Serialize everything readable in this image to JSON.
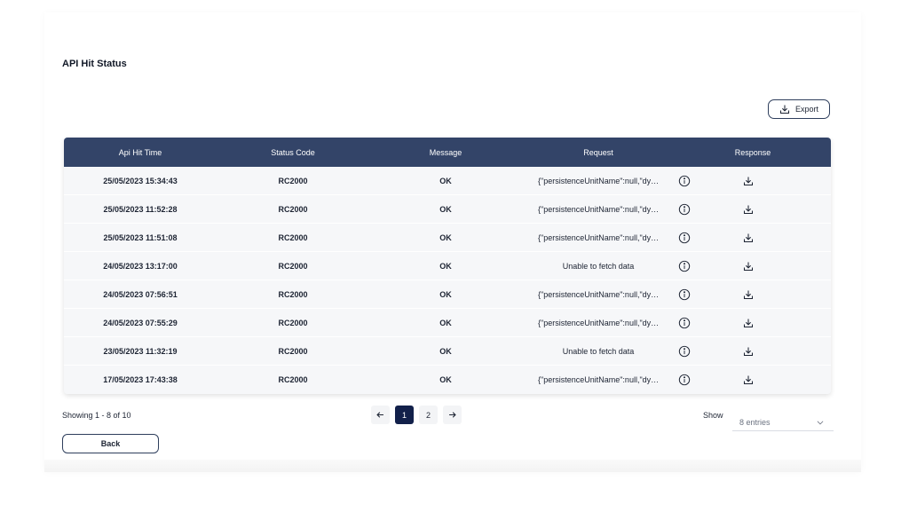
{
  "page": {
    "title": "API Hit Status"
  },
  "toolbar": {
    "export_label": "Export",
    "export_icon": "download-icon"
  },
  "table": {
    "columns": [
      "Api Hit Time",
      "Status Code",
      "Message",
      "Request",
      "Response"
    ],
    "rows": [
      {
        "time": "25/05/2023 15:34:43",
        "status": "RC2000",
        "message": "OK",
        "request": "{\"persistenceUnitName\":null,\"dynami...",
        "request_truncated": true
      },
      {
        "time": "25/05/2023 11:52:28",
        "status": "RC2000",
        "message": "OK",
        "request": "{\"persistenceUnitName\":null,\"dynami...",
        "request_truncated": true
      },
      {
        "time": "25/05/2023 11:51:08",
        "status": "RC2000",
        "message": "OK",
        "request": "{\"persistenceUnitName\":null,\"dynami...",
        "request_truncated": true
      },
      {
        "time": "24/05/2023 13:17:00",
        "status": "RC2000",
        "message": "OK",
        "request": "Unable to fetch data",
        "request_truncated": false
      },
      {
        "time": "24/05/2023 07:56:51",
        "status": "RC2000",
        "message": "OK",
        "request": "{\"persistenceUnitName\":null,\"dynami...",
        "request_truncated": true
      },
      {
        "time": "24/05/2023 07:55:29",
        "status": "RC2000",
        "message": "OK",
        "request": "{\"persistenceUnitName\":null,\"dynami...",
        "request_truncated": true
      },
      {
        "time": "23/05/2023 11:32:19",
        "status": "RC2000",
        "message": "OK",
        "request": "Unable to fetch data",
        "request_truncated": false
      },
      {
        "time": "17/05/2023 17:43:38",
        "status": "RC2000",
        "message": "OK",
        "request": "{\"persistenceUnitName\":null,\"dynami...",
        "request_truncated": true
      }
    ]
  },
  "footer": {
    "showing": "Showing 1 - 8 of 10",
    "pages": [
      "1",
      "2"
    ],
    "current_page": "1",
    "show_label": "Show",
    "entries_value": "8 entries",
    "back_label": "Back"
  },
  "colors": {
    "header_bg": "#334468",
    "active_page": "#12204a",
    "row_bg": "#f6f7f9"
  }
}
